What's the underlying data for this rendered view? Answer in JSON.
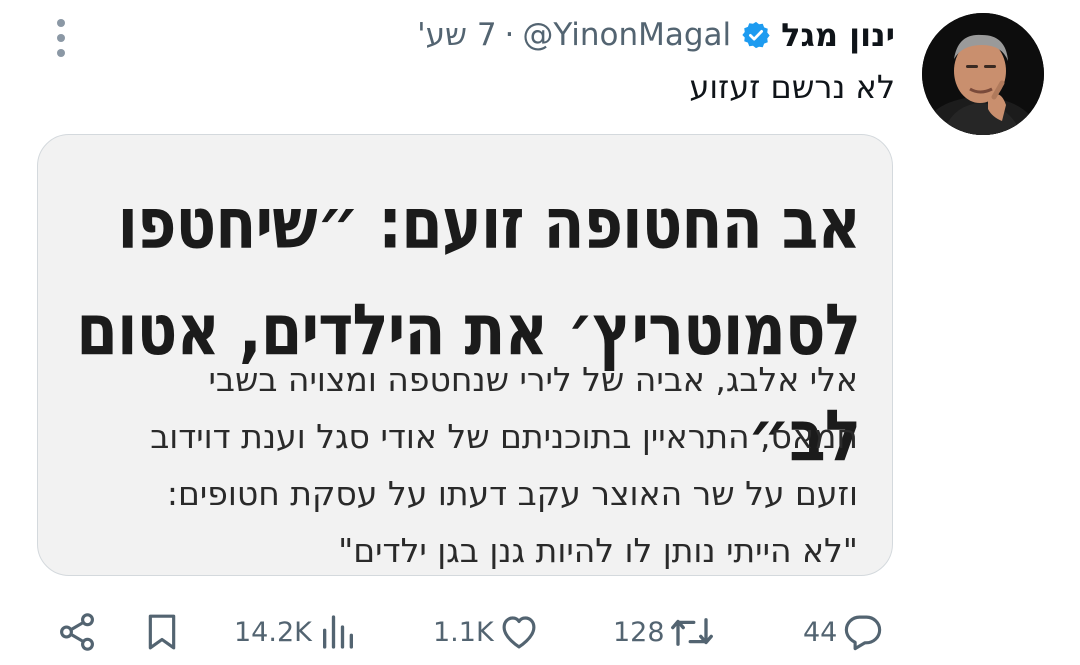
{
  "tweet": {
    "display_name": "ינון מגל",
    "handle": "@YinonMagal",
    "separator": "·",
    "time": "7 שע'",
    "text": "לא נרשם זעזוע",
    "verified_color": "#1d9bf0"
  },
  "media": {
    "headline_line1": "אב החטופה זועם: ״שיחטפו",
    "headline_line2": "לסמוטריץ׳ את הילדים, אטום לב״",
    "body_lines": [
      "אלי אלבג, אביה של לירי שנחטפה ומצויה בשבי",
      "חמאס, התראיין בתוכניתם של אודי סגל וענת דוידוב",
      "וזעם על שר האוצר עקב דעתו על עסקת חטופים:",
      "\"לא הייתי נותן לו להיות גנן בגן ילדים\""
    ]
  },
  "actions": {
    "replies": "44",
    "reposts": "128",
    "likes": "1.1K",
    "views": "14.2K",
    "icon_color": "#536471"
  }
}
